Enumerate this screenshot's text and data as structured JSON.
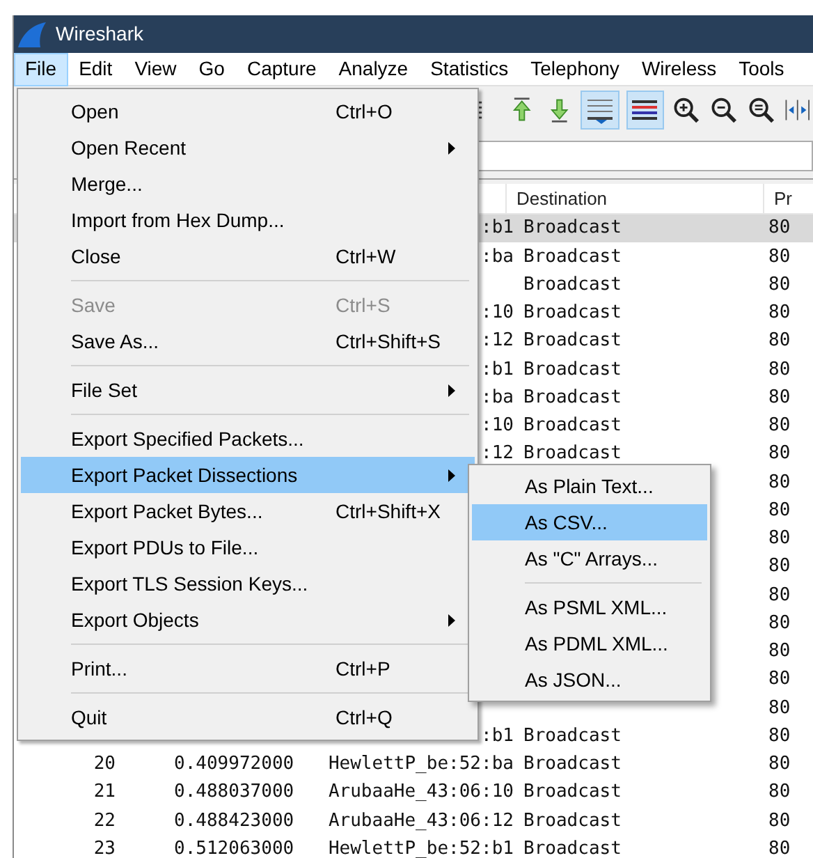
{
  "window": {
    "title": "Wireshark"
  },
  "menu_bar": [
    {
      "label": "File",
      "selected": true
    },
    {
      "label": "Edit",
      "selected": false
    },
    {
      "label": "View",
      "selected": false
    },
    {
      "label": "Go",
      "selected": false
    },
    {
      "label": "Capture",
      "selected": false
    },
    {
      "label": "Analyze",
      "selected": false
    },
    {
      "label": "Statistics",
      "selected": false
    },
    {
      "label": "Telephony",
      "selected": false
    },
    {
      "label": "Wireless",
      "selected": false
    },
    {
      "label": "Tools",
      "selected": false
    }
  ],
  "packet_list": {
    "columns": [
      {},
      {},
      {},
      {
        "label": "Destination"
      },
      {
        "label": "Pr"
      }
    ],
    "rows": [
      {
        "source": ":b1",
        "destination": "Broadcast",
        "protocol": "80",
        "selected": true
      },
      {
        "source": ":ba",
        "destination": "Broadcast",
        "protocol": "80",
        "selected": false
      },
      {
        "destination": "Broadcast",
        "protocol": "80",
        "selected": false
      },
      {
        "source": ":10",
        "destination": "Broadcast",
        "protocol": "80",
        "selected": false
      },
      {
        "source": ":12",
        "destination": "Broadcast",
        "protocol": "80",
        "selected": false
      },
      {
        "source": ":b1",
        "destination": "Broadcast",
        "protocol": "80",
        "selected": false
      },
      {
        "source": ":ba",
        "destination": "Broadcast",
        "protocol": "80",
        "selected": false
      },
      {
        "source": ":10",
        "destination": "Broadcast",
        "protocol": "80",
        "selected": false
      },
      {
        "source": ":12",
        "destination": "Broadcast",
        "protocol": "80",
        "selected": false
      },
      {
        "protocol": "80",
        "selected": false
      },
      {
        "protocol": "80",
        "selected": false
      },
      {
        "protocol": "80",
        "selected": false
      },
      {
        "protocol": "80",
        "selected": false
      },
      {
        "protocol": "80",
        "selected": false
      },
      {
        "protocol": "80",
        "selected": false
      },
      {
        "protocol": "80",
        "selected": false
      },
      {
        "protocol": "80",
        "selected": false
      },
      {
        "protocol": "80",
        "selected": false
      },
      {
        "source": ":b1",
        "destination": "Broadcast",
        "protocol": "80",
        "selected": false
      },
      {
        "no": "20",
        "time": "0.409972000",
        "source": "HewlettP_be:52:ba",
        "destination": "Broadcast",
        "protocol": "80",
        "selected": false
      },
      {
        "no": "21",
        "time": "0.488037000",
        "source": "ArubaaHe_43:06:10",
        "destination": "Broadcast",
        "protocol": "80",
        "selected": false
      },
      {
        "no": "22",
        "time": "0.488423000",
        "source": "ArubaaHe_43:06:12",
        "destination": "Broadcast",
        "protocol": "80",
        "selected": false
      },
      {
        "no": "23",
        "time": "0.512063000",
        "source": "HewlettP_be:52:b1",
        "destination": "Broadcast",
        "protocol": "80",
        "selected": false
      }
    ]
  },
  "file_menu": [
    {
      "kind": "item",
      "label": "Open",
      "shortcut": "Ctrl+O",
      "disabled": false,
      "selected": false
    },
    {
      "kind": "submenu",
      "label": "Open Recent",
      "selected": false
    },
    {
      "kind": "item",
      "label": "Merge...",
      "disabled": false,
      "selected": false
    },
    {
      "kind": "item",
      "label": "Import from Hex Dump...",
      "disabled": false,
      "selected": false
    },
    {
      "kind": "item",
      "label": "Close",
      "shortcut": "Ctrl+W",
      "disabled": false,
      "selected": false
    },
    {
      "kind": "separator"
    },
    {
      "kind": "item",
      "label": "Save",
      "shortcut": "Ctrl+S",
      "disabled": true,
      "selected": false
    },
    {
      "kind": "item",
      "label": "Save As...",
      "shortcut": "Ctrl+Shift+S",
      "disabled": false,
      "selected": false
    },
    {
      "kind": "separator"
    },
    {
      "kind": "submenu",
      "label": "File Set",
      "selected": false
    },
    {
      "kind": "separator"
    },
    {
      "kind": "item",
      "label": "Export Specified Packets...",
      "disabled": false,
      "selected": false
    },
    {
      "kind": "submenu",
      "label": "Export Packet Dissections",
      "selected": true
    },
    {
      "kind": "item",
      "label": "Export Packet Bytes...",
      "shortcut": "Ctrl+Shift+X",
      "disabled": false,
      "selected": false
    },
    {
      "kind": "item",
      "label": "Export PDUs to File...",
      "disabled": false,
      "selected": false
    },
    {
      "kind": "item",
      "label": "Export TLS Session Keys...",
      "disabled": false,
      "selected": false
    },
    {
      "kind": "submenu",
      "label": "Export Objects",
      "selected": false
    },
    {
      "kind": "separator"
    },
    {
      "kind": "item",
      "label": "Print...",
      "shortcut": "Ctrl+P",
      "disabled": false,
      "selected": false
    },
    {
      "kind": "separator"
    },
    {
      "kind": "item",
      "label": "Quit",
      "shortcut": "Ctrl+Q",
      "disabled": false,
      "selected": false
    }
  ],
  "export_submenu": [
    {
      "kind": "item",
      "label": "As Plain Text...",
      "selected": false
    },
    {
      "kind": "item",
      "label": "As CSV...",
      "selected": true
    },
    {
      "kind": "item",
      "label": "As \"C\" Arrays...",
      "selected": false
    },
    {
      "kind": "separator"
    },
    {
      "kind": "item",
      "label": "As PSML XML...",
      "selected": false
    },
    {
      "kind": "item",
      "label": "As PDML XML...",
      "selected": false
    },
    {
      "kind": "item",
      "label": "As JSON...",
      "selected": false
    }
  ]
}
